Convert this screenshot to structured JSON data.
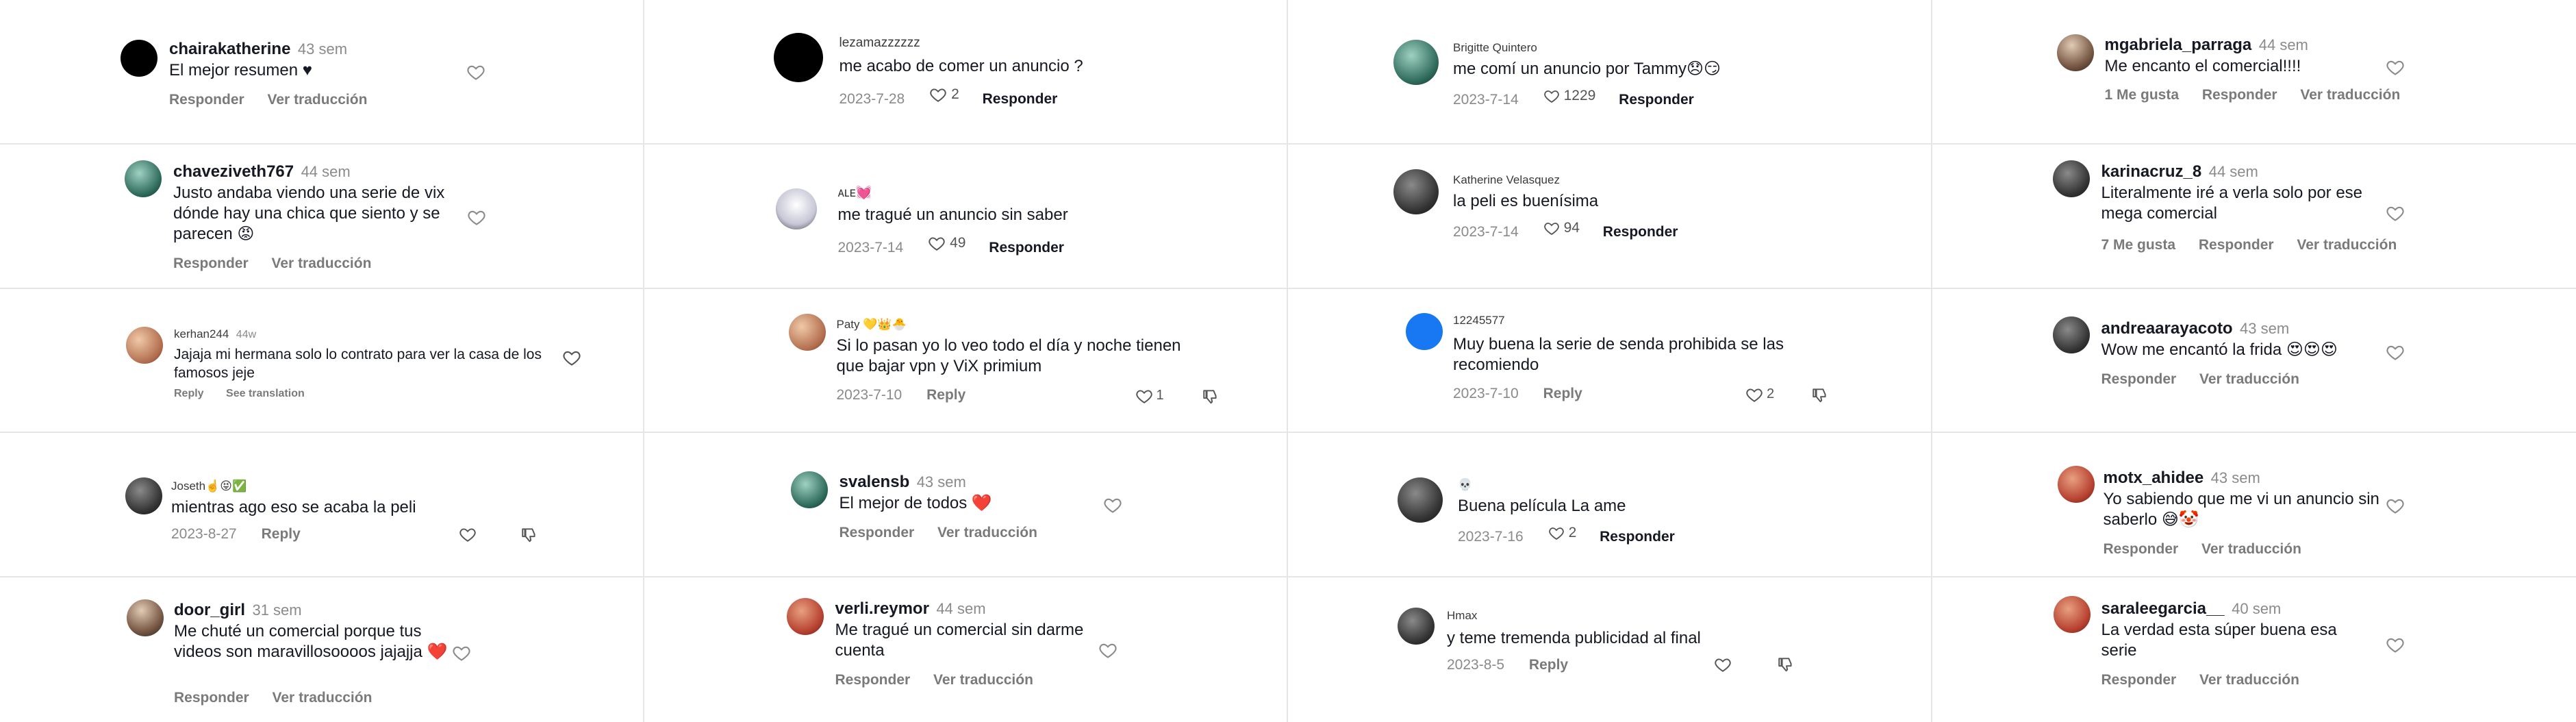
{
  "comments": [
    {
      "user": "chairakatherine",
      "time": "43 sem",
      "text": "El mejor resumen ♥",
      "reply": "Responder",
      "translate": "Ver traducción"
    },
    {
      "user": "lezamazzzzzz",
      "text": "me acabo de comer un anuncio ?",
      "date": "2023-7-28",
      "likes": "2",
      "reply": "Responder"
    },
    {
      "user": "Brigitte Quintero",
      "text": "me comí un anuncio por Tammy😞😏",
      "date": "2023-7-14",
      "likes": "1229",
      "reply": "Responder"
    },
    {
      "user": "mgabriela_parraga",
      "time": "44 sem",
      "text": "Me encanto el comercial!!!!",
      "likes_label": "1 Me gusta",
      "reply": "Responder",
      "translate": "Ver traducción"
    },
    {
      "user": "chaveziveth767",
      "time": "44 sem",
      "text": "Justo andaba viendo una serie de vix dónde hay una chica que siento y se parecen 😡",
      "reply": "Responder",
      "translate": "Ver traducción"
    },
    {
      "user": "ᴀʟᴇ💓",
      "text": "me tragué un anuncio sin saber",
      "date": "2023-7-14",
      "likes": "49",
      "reply": "Responder"
    },
    {
      "user": "Katherine Velasquez",
      "text": "la peli es buenísima",
      "date": "2023-7-14",
      "likes": "94",
      "reply": "Responder"
    },
    {
      "user": "karinacruz_8",
      "time": "44 sem",
      "text": "Literalmente iré a verla solo por ese mega comercial",
      "likes_label": "7 Me gusta",
      "reply": "Responder",
      "translate": "Ver traducción"
    },
    {
      "user": "kerhan244",
      "time": "44w",
      "text": "Jajaja mi hermana solo lo contrato para ver la casa de los famosos jeje",
      "reply": "Reply",
      "translate": "See translation"
    },
    {
      "user": "Paty 💛👑🐣",
      "text": "Si lo pasan yo lo veo todo el día y noche tienen que bajar vpn y ViX primium",
      "date": "2023-7-10",
      "reply": "Reply",
      "likes": "1"
    },
    {
      "user": "12245577",
      "text": "Muy buena la serie de senda prohibida se las recomiendo",
      "date": "2023-7-10",
      "reply": "Reply",
      "likes": "2"
    },
    {
      "user": "andreaarayacoto",
      "time": "43 sem",
      "text": "Wow me encantó la frida 😍😍😍",
      "reply": "Responder",
      "translate": "Ver traducción"
    },
    {
      "user": "Joseth☝️😝✅",
      "text": "mientras ago eso se acaba la peli",
      "date": "2023-8-27",
      "reply": "Reply"
    },
    {
      "user": "svalensb",
      "time": "43 sem",
      "text": "El mejor de todos ❤️",
      "reply": "Responder",
      "translate": "Ver traducción"
    },
    {
      "user": "💀",
      "text": "Buena película La ame",
      "date": "2023-7-16",
      "likes": "2",
      "reply": "Responder"
    },
    {
      "user": "motx_ahidee",
      "time": "43 sem",
      "text": "Yo sabiendo que me vi un anuncio sin saberlo 😅🤡",
      "reply": "Responder",
      "translate": "Ver traducción"
    },
    {
      "user": "door_girl",
      "time": "31 sem",
      "text": "Me chuté un comercial porque tus videos son maravillosoooos jajajja ❤️",
      "reply": "Responder",
      "translate": "Ver traducción"
    },
    {
      "user": "verli.reymor",
      "time": "44 sem",
      "text": "Me tragué un comercial sin darme cuenta",
      "reply": "Responder",
      "translate": "Ver traducción"
    },
    {
      "user": "Hmax",
      "text": "y teme tremenda publicidad al final",
      "date": "2023-8-5",
      "reply": "Reply"
    },
    {
      "user": "saraleegarcia__",
      "time": "40 sem",
      "text": "La verdad esta súper buena esa serie",
      "reply": "Responder",
      "translate": "Ver traducción"
    }
  ],
  "icons": {
    "like": "heart-outline-icon",
    "dislike": "thumbs-down-icon"
  },
  "colors": {
    "text": "#161823",
    "muted": "#8a8a8a",
    "divider": "#e6e6e6"
  }
}
